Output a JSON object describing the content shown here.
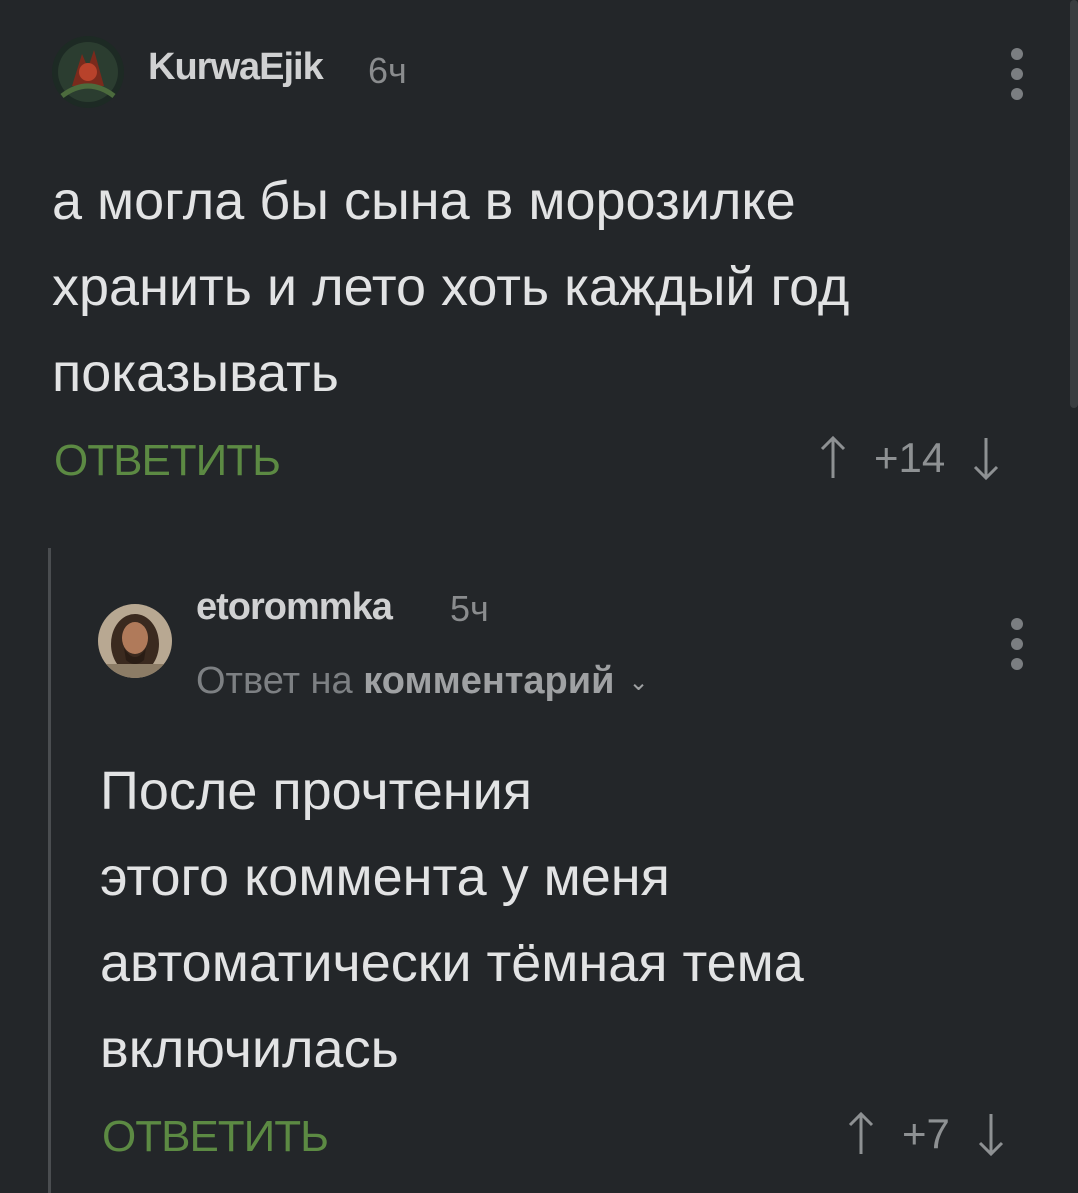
{
  "comments": [
    {
      "username": "KurwaEjik",
      "time": "6ч",
      "text_lines": [
        "а могла бы сына в морозилке",
        "хранить и лето хоть каждый год",
        "показывать"
      ],
      "reply_label": "ОТВЕТИТЬ",
      "score": "+14"
    },
    {
      "username": "etorommka",
      "time": "5ч",
      "reply_to_prefix": "Ответ на",
      "reply_to_target": "комментарий",
      "text_lines": [
        "После прочтения",
        "этого коммента у меня",
        "автоматически тёмная тема",
        "включилась"
      ],
      "reply_label": "ОТВЕТИТЬ",
      "score": "+7"
    }
  ],
  "colors": {
    "background": "#232629",
    "reply_accent": "#5c8a43"
  },
  "icons": {
    "upvote": "arrow-up-icon",
    "downvote": "arrow-down-icon",
    "more": "more-vertical-icon",
    "expand": "chevron-down-icon"
  }
}
